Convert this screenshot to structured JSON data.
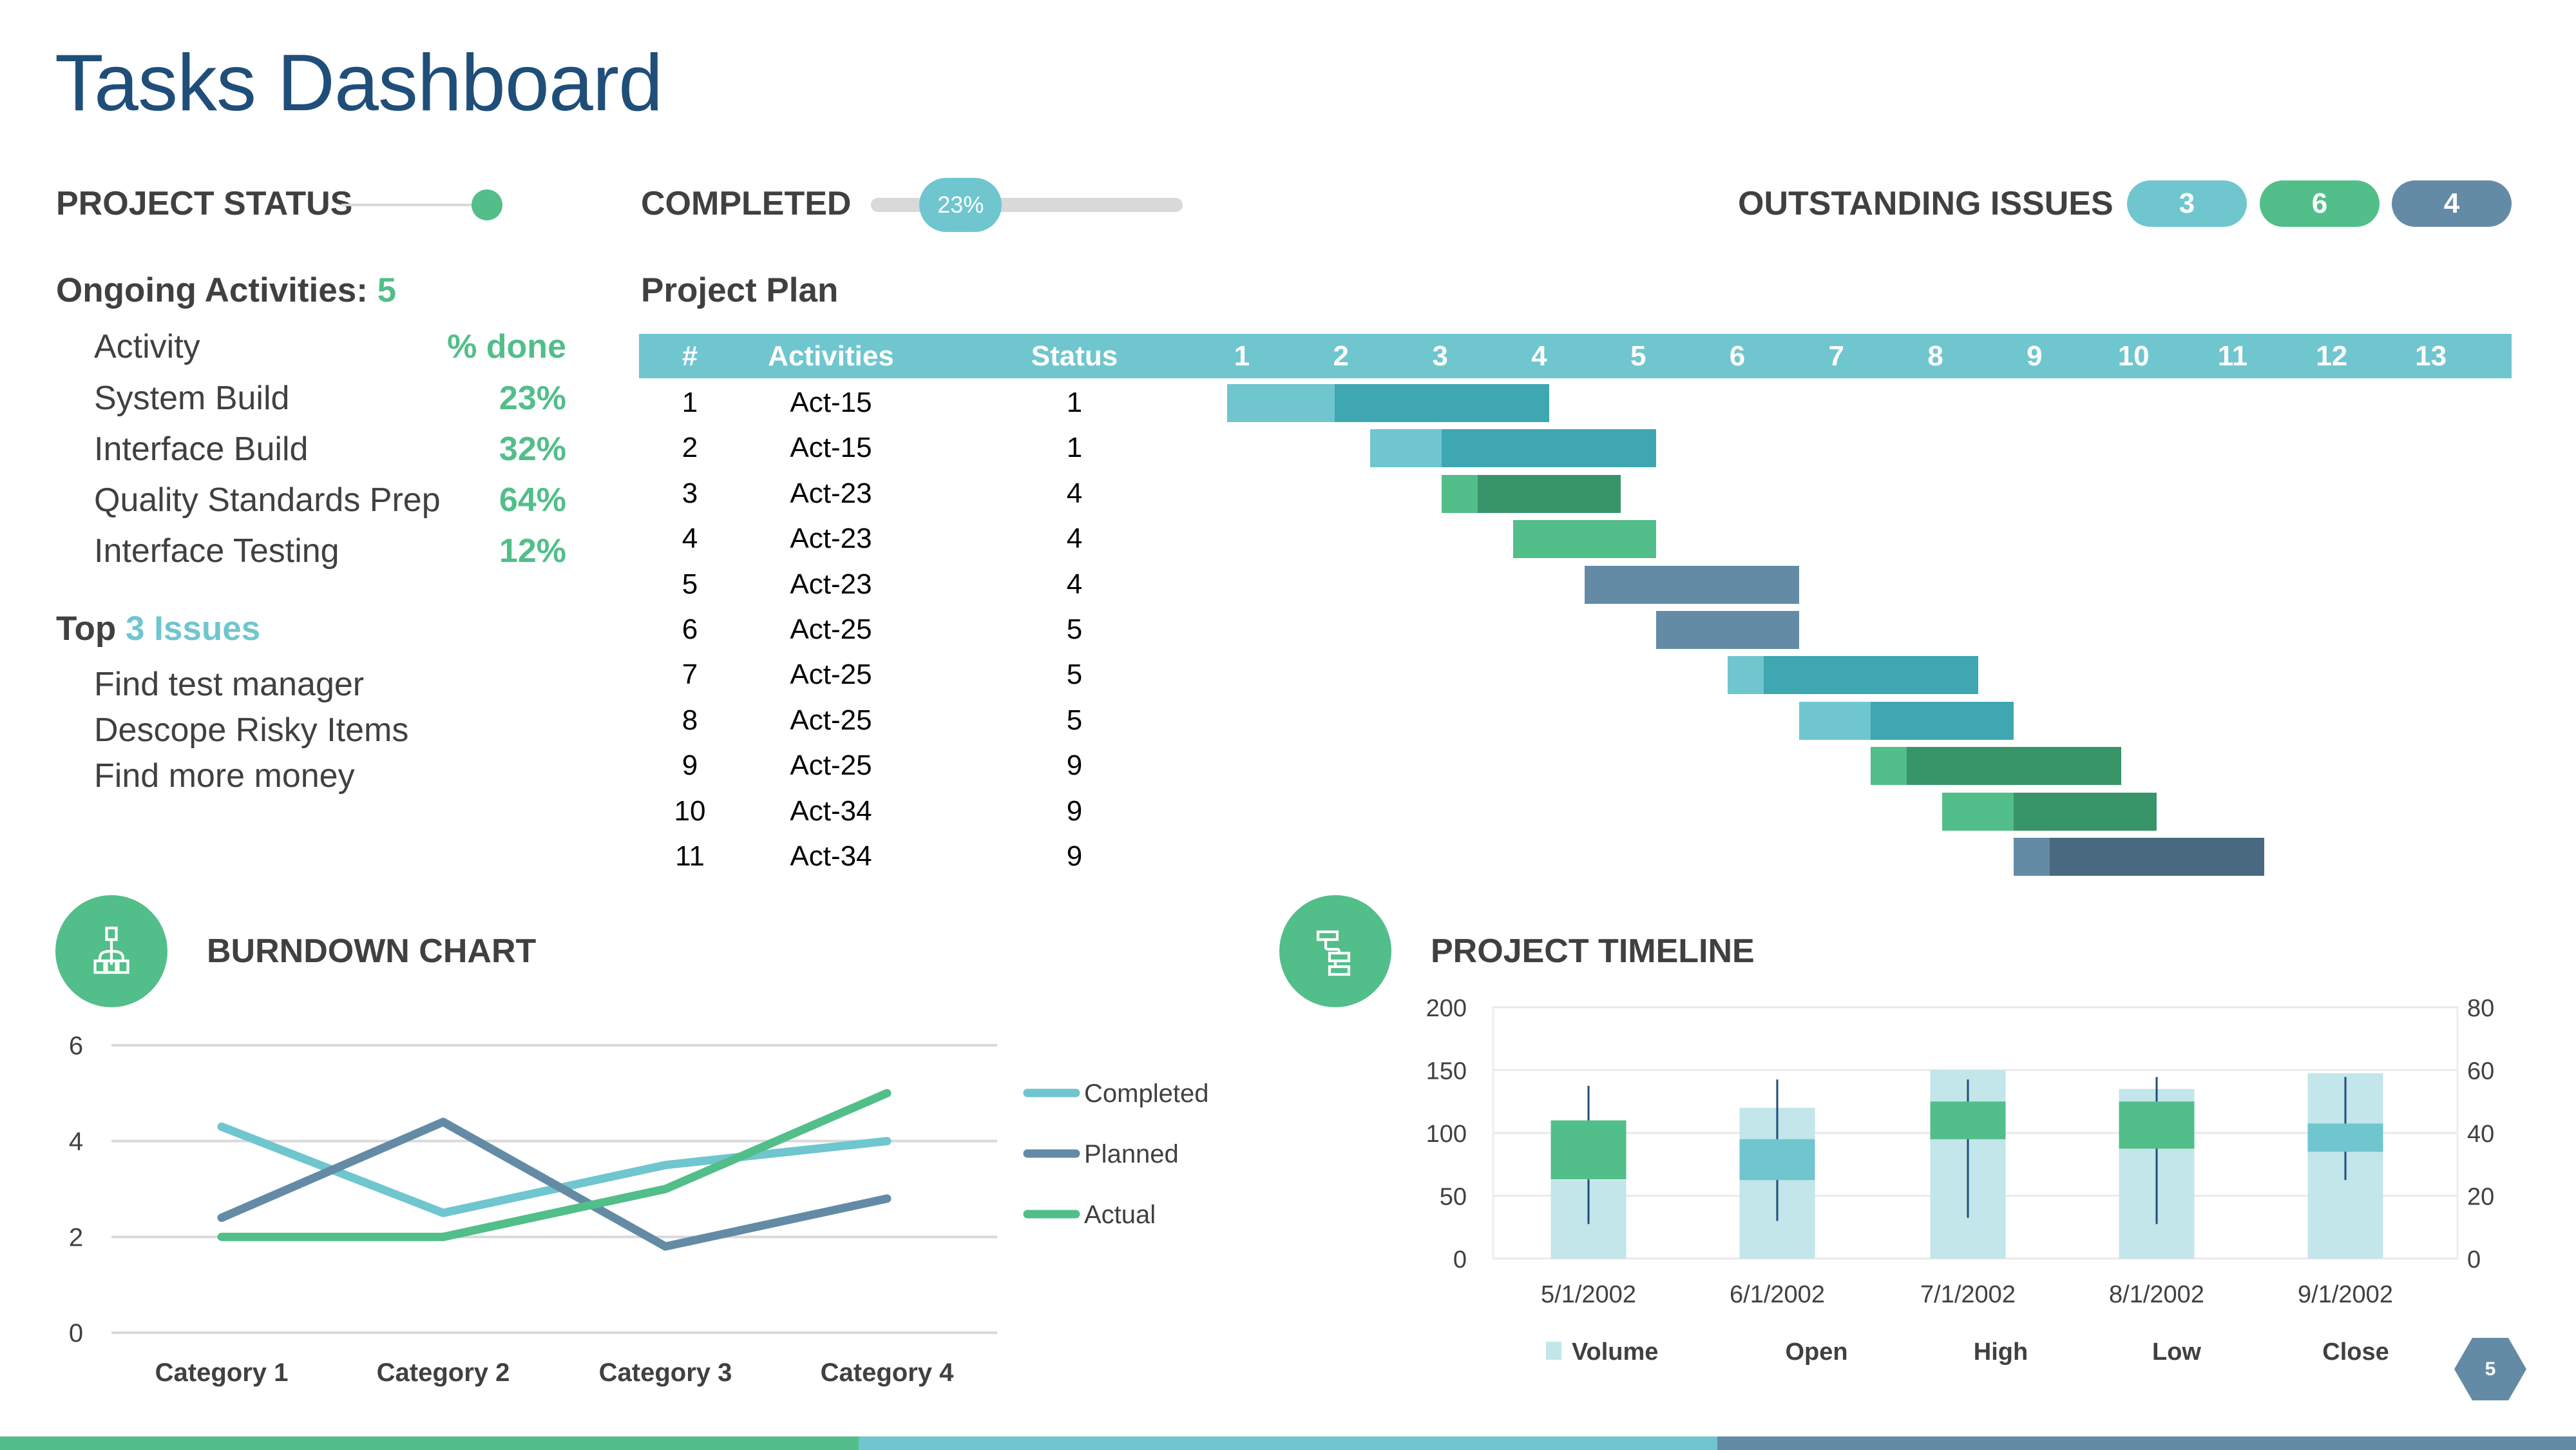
{
  "title": "Tasks Dashboard",
  "colors": {
    "teal": "#6fc6ce",
    "teal_dark": "#3ea7b1",
    "green": "#52be8a",
    "green_dark": "#38956a",
    "slate": "#648ba5",
    "slate_dark": "#48697f",
    "navy": "#1f4e79",
    "volume": "#c2e6e9"
  },
  "status_bar": {
    "project_status_label": "PROJECT STATUS",
    "completed_label": "COMPLETED",
    "completed_pct_text": "23%",
    "completed_fraction": 0.23,
    "outstanding_label": "OUTSTANDING ISSUES",
    "issue_counts": [
      {
        "value": "3",
        "color": "#6fc6ce"
      },
      {
        "value": "6",
        "color": "#52be8a"
      },
      {
        "value": "4",
        "color": "#648ba5"
      }
    ]
  },
  "ongoing": {
    "label": "Ongoing Activities:",
    "count": "5",
    "col_activity": "Activity",
    "col_done": "% done",
    "items": [
      {
        "name": "System Build",
        "pct": "23%"
      },
      {
        "name": "Interface Build",
        "pct": "32%"
      },
      {
        "name": "Quality Standards Prep",
        "pct": "64%"
      },
      {
        "name": "Interface Testing",
        "pct": "12%"
      }
    ]
  },
  "issues": {
    "label_prefix": "Top",
    "label_highlight": "3 Issues",
    "items": [
      "Find test manager",
      "Descope Risky Items",
      "Find more money"
    ]
  },
  "project_plan": {
    "title": "Project Plan",
    "headers": {
      "num": "#",
      "activities": "Activities",
      "status": "Status"
    },
    "weeks": [
      "1",
      "2",
      "3",
      "4",
      "5",
      "6",
      "7",
      "8",
      "9",
      "10",
      "11",
      "12",
      "13"
    ],
    "rows": [
      {
        "num": "1",
        "activity": "Act-15",
        "status": "1",
        "start": 0,
        "split": 3,
        "end": 9,
        "tone": "teal"
      },
      {
        "num": "2",
        "activity": "Act-15",
        "status": "1",
        "start": 4,
        "split": 6,
        "end": 12,
        "tone": "teal"
      },
      {
        "num": "3",
        "activity": "Act-23",
        "status": "4",
        "start": 6,
        "split": 7,
        "end": 11,
        "tone": "green"
      },
      {
        "num": "4",
        "activity": "Act-23",
        "status": "4",
        "start": 8,
        "split": 12,
        "end": 12,
        "tone": "green"
      },
      {
        "num": "5",
        "activity": "Act-23",
        "status": "4",
        "start": 10,
        "split": 16,
        "end": 16,
        "tone": "slate"
      },
      {
        "num": "6",
        "activity": "Act-25",
        "status": "5",
        "start": 12,
        "split": 16,
        "end": 16,
        "tone": "slate"
      },
      {
        "num": "7",
        "activity": "Act-25",
        "status": "5",
        "start": 14,
        "split": 15,
        "end": 21,
        "tone": "teal"
      },
      {
        "num": "8",
        "activity": "Act-25",
        "status": "5",
        "start": 16,
        "split": 18,
        "end": 22,
        "tone": "teal"
      },
      {
        "num": "9",
        "activity": "Act-25",
        "status": "9",
        "start": 18,
        "split": 19,
        "end": 25,
        "tone": "green"
      },
      {
        "num": "10",
        "activity": "Act-34",
        "status": "9",
        "start": 20,
        "split": 22,
        "end": 26,
        "tone": "green"
      },
      {
        "num": "11",
        "activity": "Act-34",
        "status": "9",
        "start": 22,
        "split": 23,
        "end": 29,
        "tone": "slate"
      }
    ]
  },
  "burndown": {
    "title": "BURNDOWN CHART",
    "icon": "hierarchy-icon"
  },
  "timeline": {
    "title": "PROJECT TIMELINE",
    "icon": "timeline-icon"
  },
  "page_number": "5",
  "chart_data": [
    {
      "type": "line",
      "title": "BURNDOWN CHART",
      "categories": [
        "Category 1",
        "Category 2",
        "Category 3",
        "Category 4"
      ],
      "series": [
        {
          "name": "Completed",
          "values": [
            4.3,
            2.5,
            3.5,
            4.0
          ],
          "color": "#6fc6ce"
        },
        {
          "name": "Planned",
          "values": [
            2.4,
            4.4,
            1.8,
            2.8
          ],
          "color": "#648ba5"
        },
        {
          "name": "Actual",
          "values": [
            2.0,
            2.0,
            3.0,
            5.0
          ],
          "color": "#52be8a"
        }
      ],
      "ylim": [
        0,
        6
      ],
      "yticks": [
        "0",
        "2",
        "4",
        "6"
      ],
      "grid": true,
      "legend": "right"
    },
    {
      "type": "candlestick",
      "title": "PROJECT TIMELINE",
      "categories": [
        "5/1/2002",
        "6/1/2002",
        "7/1/2002",
        "8/1/2002",
        "9/1/2002"
      ],
      "volume": [
        25,
        48,
        60,
        54,
        59
      ],
      "open": [
        63,
        95,
        95,
        87.5,
        107.5
      ],
      "high": [
        137.5,
        142.5,
        142.5,
        144.5,
        144.5
      ],
      "low": [
        27.5,
        30,
        32.5,
        27.5,
        62.5
      ],
      "close": [
        110,
        62.5,
        125,
        125,
        85
      ],
      "ylim": [
        0,
        200
      ],
      "yticks": [
        "0",
        "50",
        "100",
        "150",
        "200"
      ],
      "y2lim": [
        0,
        80
      ],
      "y2ticks": [
        "0",
        "20",
        "40",
        "60",
        "80"
      ],
      "legend_items": [
        "Volume",
        "Open",
        "High",
        "Low",
        "Close"
      ],
      "legend": "bottom",
      "grid": true
    }
  ]
}
